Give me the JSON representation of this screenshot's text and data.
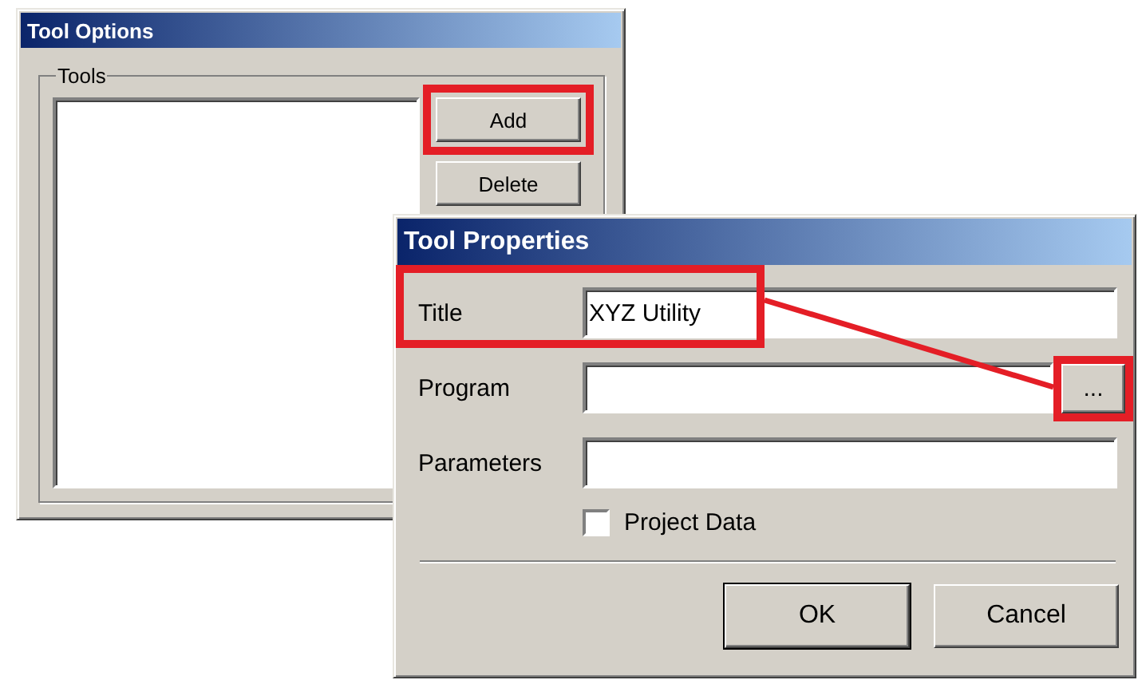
{
  "windows": [
    {
      "kind": "options",
      "title": "Tool Options",
      "group": {
        "label": "Tools"
      },
      "buttons": [
        {
          "label": "Add",
          "highlighted": true
        },
        {
          "label": "Delete",
          "highlighted": false
        }
      ]
    },
    {
      "kind": "properties",
      "title": "Tool Properties",
      "fields": [
        {
          "label": "Title",
          "value": "XYZ Utility",
          "highlighted": true
        },
        {
          "label": "Program",
          "highlighted": false,
          "browse": {
            "label": "...",
            "highlighted": true
          }
        },
        {
          "label": "Parameters",
          "highlighted": false
        }
      ],
      "checkbox": {
        "label": "Project Data",
        "checked": false
      },
      "buttons": [
        {
          "label": "OK",
          "default": true
        },
        {
          "label": "Cancel",
          "default": false
        }
      ]
    }
  ],
  "connector_line": true
}
